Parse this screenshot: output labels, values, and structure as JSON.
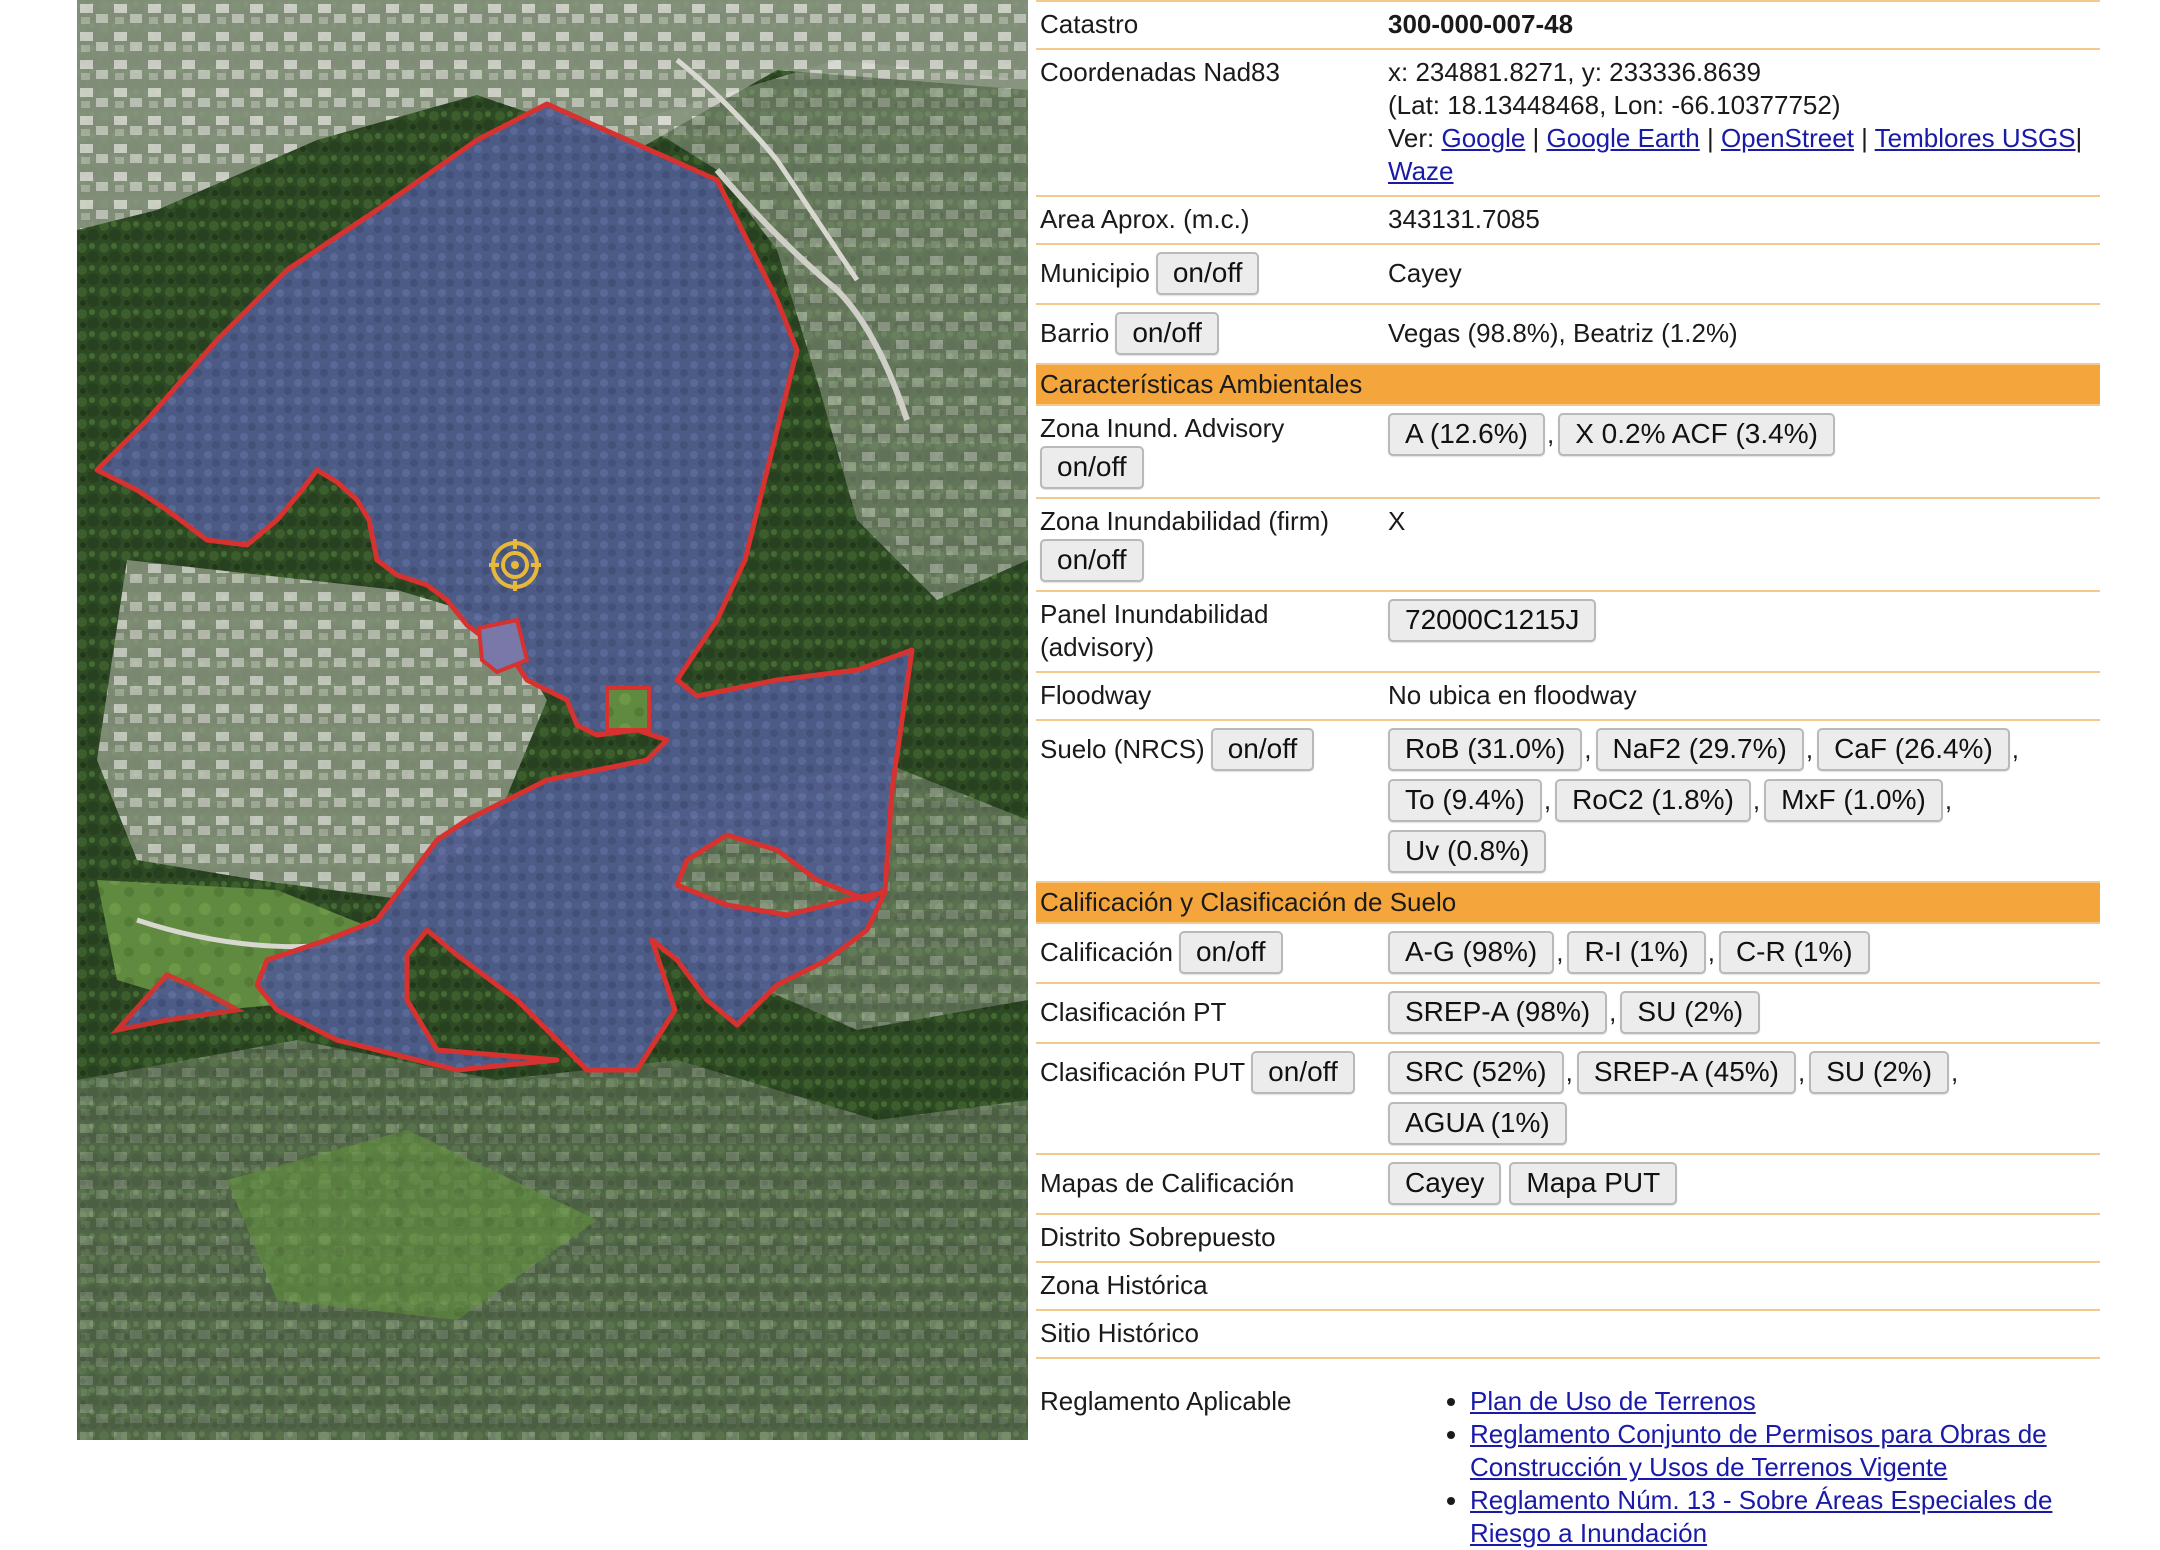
{
  "map": {
    "marker_icon": "crosshair-target-icon",
    "colors": {
      "boundary": "#d7322f",
      "parcel_fill": "#5b6aa6",
      "vegetation": "#2f4a25"
    }
  },
  "rows_top": [
    {
      "label": "Catastro",
      "value": "300-000-007-48"
    },
    {
      "label": "Coordenadas Nad83",
      "line1": "x: 234881.8271, y: 233336.8639",
      "line2": "(Lat: 18.13448468, Lon: -66.10377752)",
      "ver_label": "Ver:",
      "links": [
        "Google",
        "Google Earth",
        "OpenStreet",
        "Temblores USGS",
        "Waze"
      ]
    },
    {
      "label": "Area Aprox. (m.c.)",
      "value": "343131.7085"
    },
    {
      "label": "Municipio",
      "toggle": "on/off",
      "value": "Cayey"
    },
    {
      "label": "Barrio",
      "toggle": "on/off",
      "value": "Vegas (98.8%), Beatriz (1.2%)"
    }
  ],
  "section_env": "Características Ambientales",
  "env": {
    "zona_advisory": {
      "label": "Zona Inund. Advisory",
      "toggle": "on/off",
      "buttons": [
        "A (12.6%)",
        "X 0.2% ACF (3.4%)"
      ]
    },
    "zona_firm": {
      "label": "Zona Inundabilidad (firm)",
      "toggle": "on/off",
      "value": "X"
    },
    "panel": {
      "label": "Panel Inundabilidad (advisory)",
      "button": "72000C1215J"
    },
    "floodway": {
      "label": "Floodway",
      "value": "No ubica en floodway"
    },
    "suelo": {
      "label": "Suelo (NRCS)",
      "toggle": "on/off",
      "buttons": [
        "RoB (31.0%)",
        "NaF2 (29.7%)",
        "CaF (26.4%)",
        "To (9.4%)",
        "RoC2 (1.8%)",
        "MxF (1.0%)",
        "Uv (0.8%)"
      ]
    }
  },
  "section_calif": "Calificación y Clasificación de Suelo",
  "calif": {
    "calificacion": {
      "label": "Calificación",
      "toggle": "on/off",
      "buttons": [
        "A-G (98%)",
        "R-I (1%)",
        "C-R (1%)"
      ]
    },
    "clas_pt": {
      "label": "Clasificación PT",
      "buttons": [
        "SREP-A (98%)",
        "SU (2%)"
      ]
    },
    "clas_put": {
      "label": "Clasificación PUT",
      "toggle": "on/off",
      "buttons": [
        "SRC (52%)",
        "SREP-A (45%)",
        "SU (2%)",
        "AGUA (1%)"
      ]
    },
    "mapas": {
      "label": "Mapas de Calificación",
      "buttons": [
        "Cayey",
        "Mapa PUT"
      ]
    },
    "distrito": {
      "label": "Distrito Sobrepuesto"
    },
    "zona_hist": {
      "label": "Zona Histórica"
    },
    "sitio_hist": {
      "label": "Sitio Histórico"
    }
  },
  "reglamento": {
    "label": "Reglamento Aplicable",
    "links": [
      "Plan de Uso de Terrenos",
      "Reglamento Conjunto de Permisos para Obras de Construcción y Usos de Terrenos Vigente",
      "Reglamento Núm. 13 - Sobre Áreas Especiales de Riesgo a Inundación"
    ]
  }
}
